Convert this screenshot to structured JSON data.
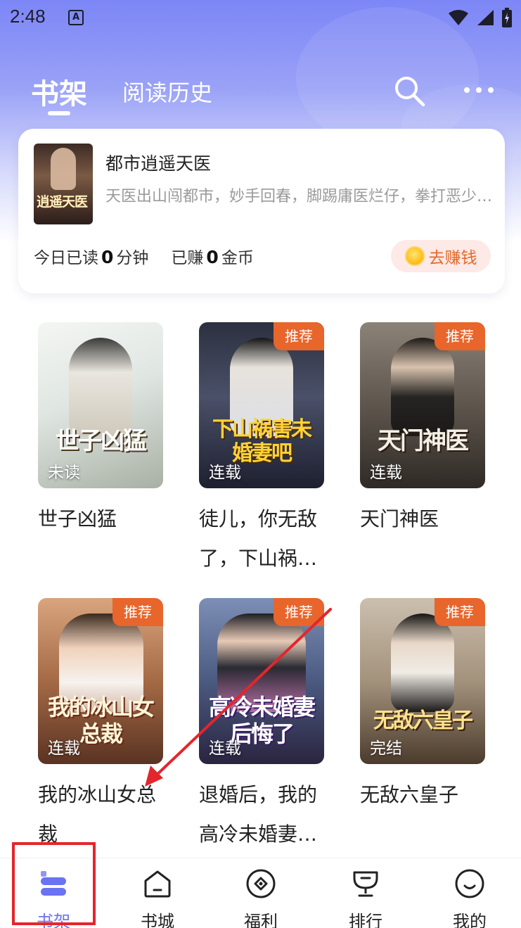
{
  "status_bar": {
    "time": "2:48",
    "app_icon_letter": "A"
  },
  "header": {
    "tab_shelf": "书架",
    "tab_history": "阅读历史"
  },
  "continue_card": {
    "cover_art_title": "逍遥天医",
    "book_title": "都市逍遥天医",
    "description": "天医出山闯都市，妙手回春，脚踢庸医烂仔，拳打恶少…",
    "read_today_prefix": "今日已读",
    "read_today_value": "0",
    "read_today_unit": "分钟",
    "earned_prefix": "已赚",
    "earned_value": "0",
    "earned_unit": "金币",
    "earn_button": "去赚钱"
  },
  "books": [
    {
      "cover_title": "世子凶猛",
      "badge": "",
      "status": "未读",
      "name": "世子凶猛",
      "bg": "#e8ecea",
      "fg": "#3a3a3a",
      "title_color": "#ffffff",
      "title_shadow": "#4a3a20"
    },
    {
      "cover_title": "下山祸害未婚妻吧",
      "badge": "推荐",
      "status": "连载",
      "name": "徒儿，你无敌了，下山祸…",
      "bg": "#3a4156",
      "fg": "#e2e4ea",
      "title_color": "#ffd23a",
      "title_shadow": "#4a2a00"
    },
    {
      "cover_title": "天门神医",
      "badge": "推荐",
      "status": "连载",
      "name": "天门神医",
      "bg": "#6a625a",
      "fg": "#2a2622",
      "title_color": "#f3f0e6",
      "title_shadow": "#2a1a10"
    },
    {
      "cover_title": "我的冰山女总裁",
      "badge": "推荐",
      "status": "连载",
      "name": "我的冰山女总裁",
      "bg": "#b57a52",
      "fg": "#f2d7c2",
      "title_color": "#fff6d8",
      "title_shadow": "#6a2a18"
    },
    {
      "cover_title": "高冷未婚妻后悔了",
      "badge": "推荐",
      "status": "连载",
      "name": "退婚后，我的高冷未婚妻…",
      "bg": "#4b5a80",
      "fg": "#e6c6c6",
      "title_color": "#ffffff",
      "title_shadow": "#3a1a6a"
    },
    {
      "cover_title": "无敌六皇子",
      "badge": "推荐",
      "status": "完结",
      "name": "无敌六皇子",
      "bg": "#b9a994",
      "fg": "#2a2420",
      "title_color": "#ffe28a",
      "title_shadow": "#3a2010"
    }
  ],
  "bottom_nav": [
    {
      "label": "书架",
      "icon": "bookshelf-icon",
      "active": true
    },
    {
      "label": "书城",
      "icon": "bookstore-icon",
      "active": false
    },
    {
      "label": "福利",
      "icon": "welfare-icon",
      "active": false
    },
    {
      "label": "排行",
      "icon": "ranking-trophy-icon",
      "active": false
    },
    {
      "label": "我的",
      "icon": "profile-smile-icon",
      "active": false
    }
  ],
  "colors": {
    "accent": "#6a73f2",
    "badge": "#e8652b",
    "earn_text": "#e36a2a",
    "annotation_red": "#e3262c"
  }
}
